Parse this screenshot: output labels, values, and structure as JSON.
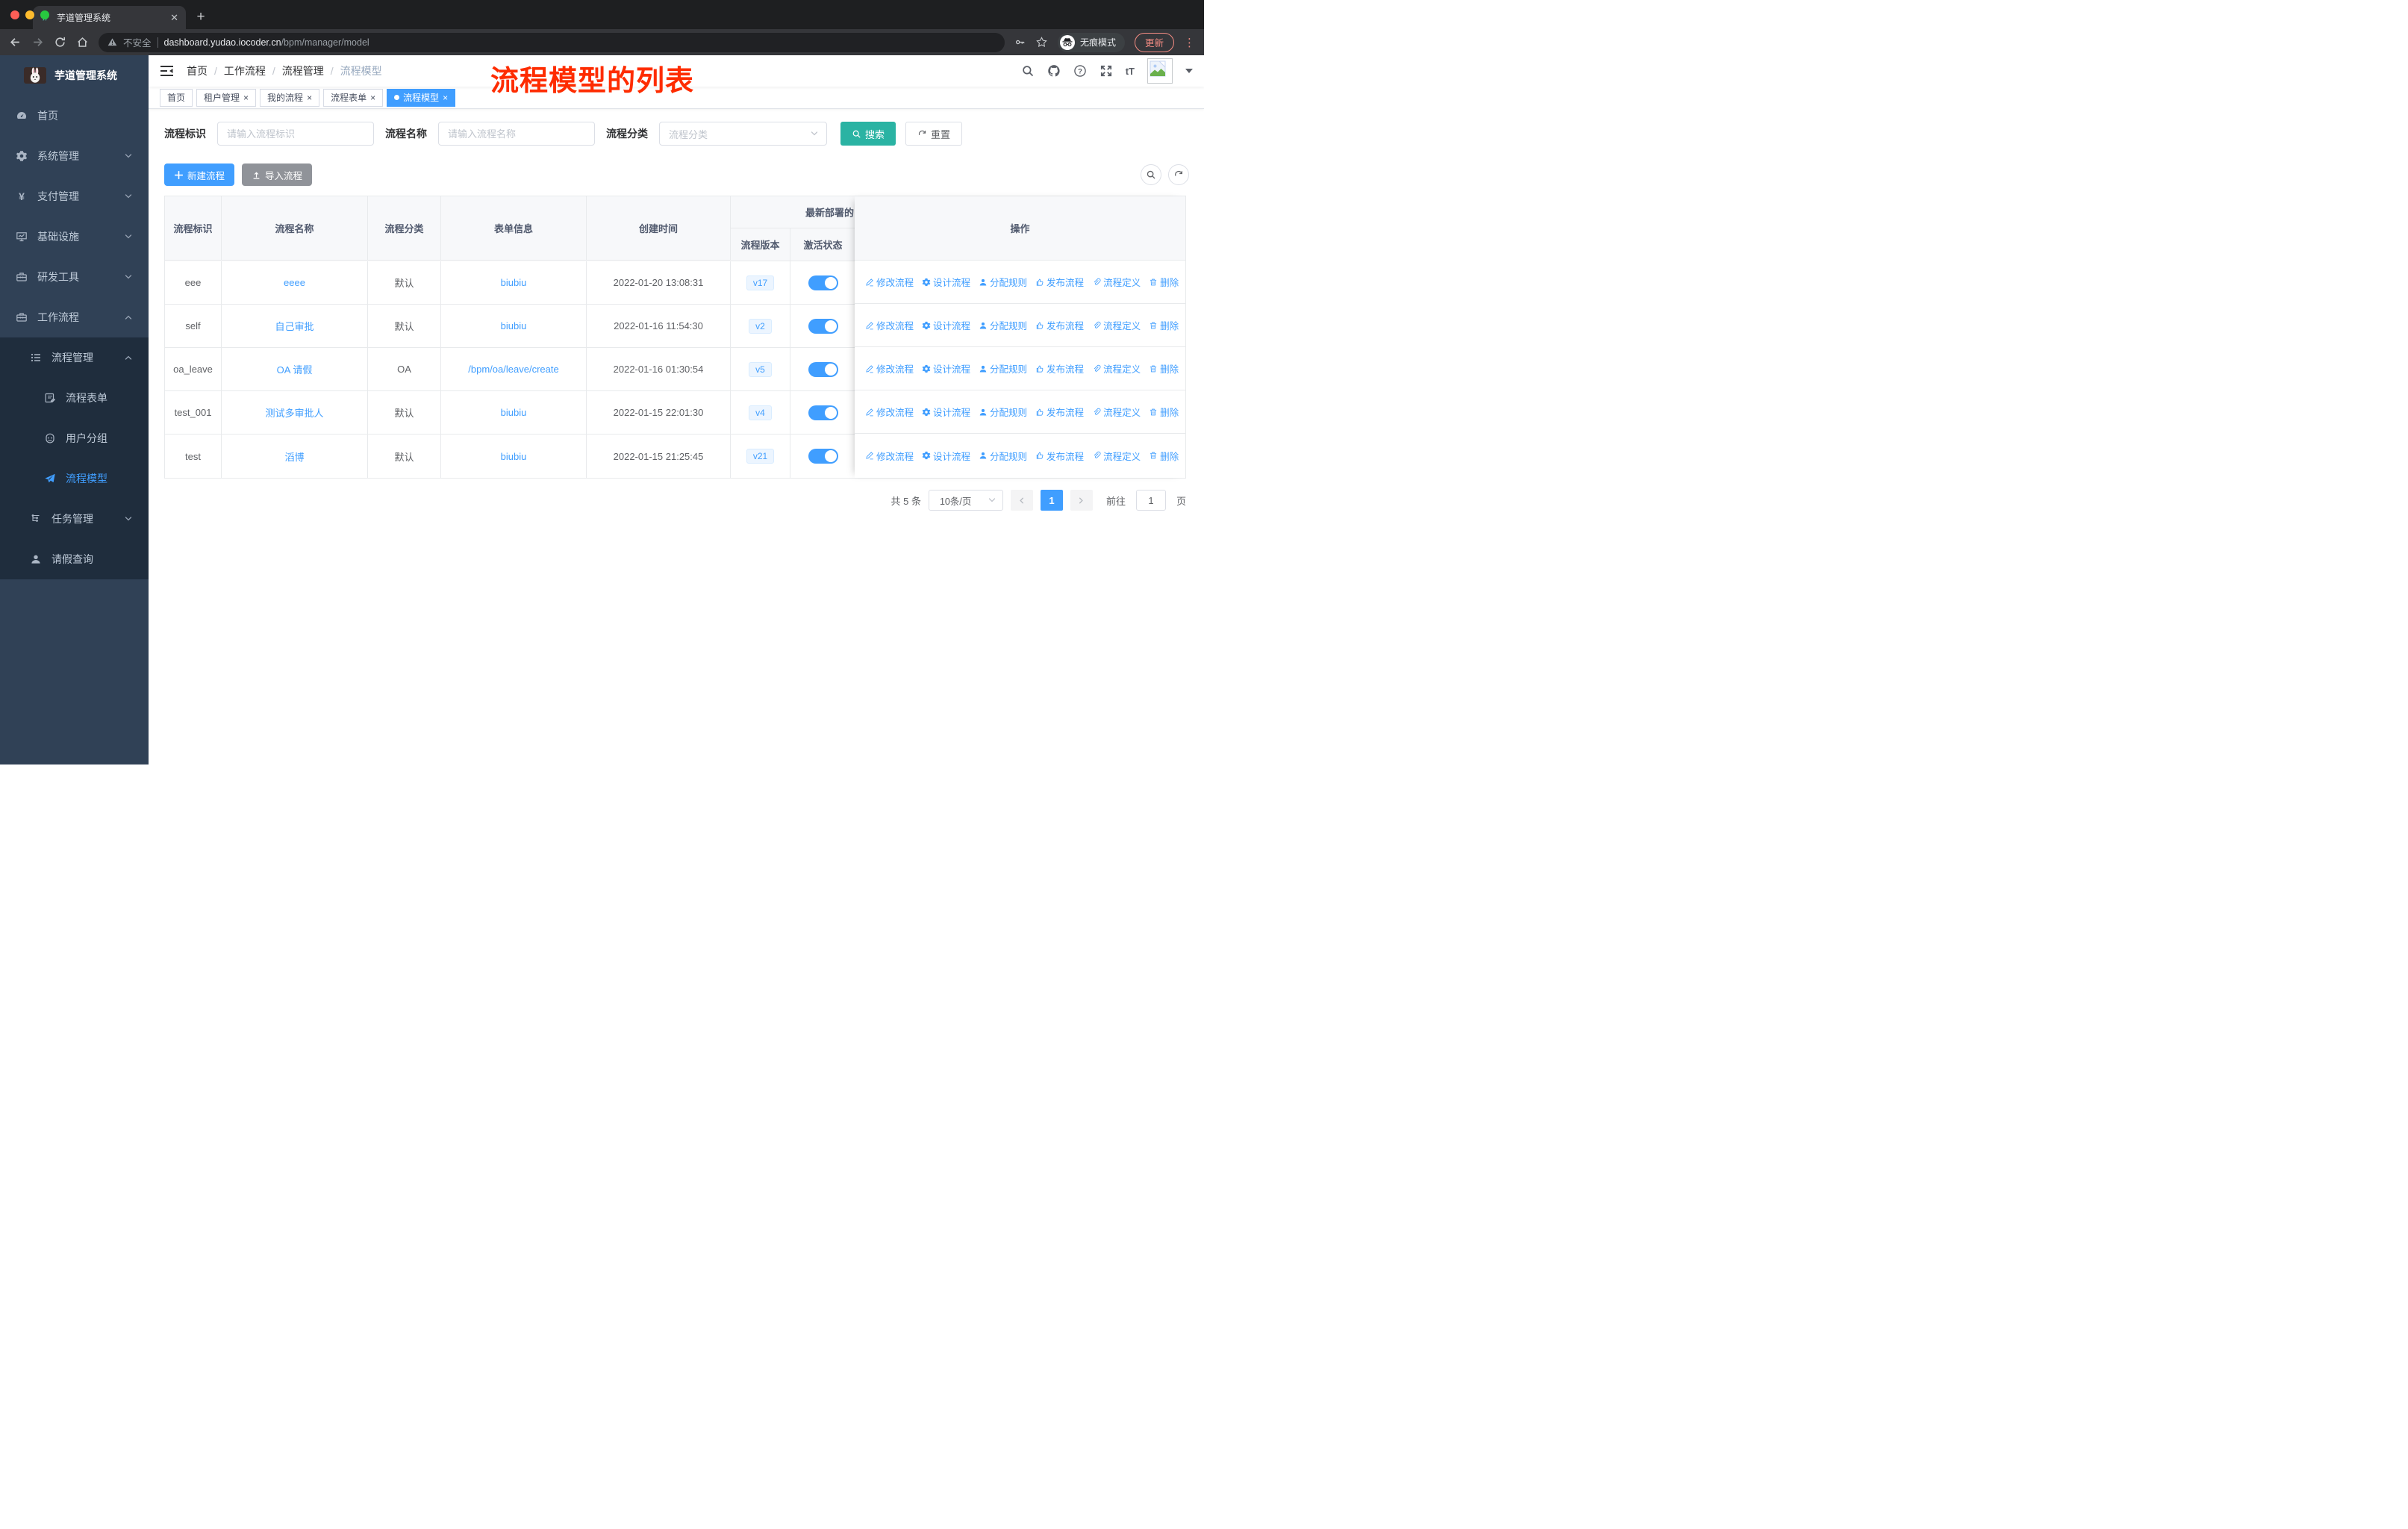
{
  "browser": {
    "tab_title": "芋道管理系统",
    "security_label": "不安全",
    "url_host": "dashboard.yudao.iocoder.cn",
    "url_path": "/bpm/manager/model",
    "incognito_label": "无痕模式",
    "update_label": "更新"
  },
  "sidebar": {
    "title": "芋道管理系统",
    "items": [
      {
        "label": "首页",
        "icon": "dashboard-icon",
        "level": 1
      },
      {
        "label": "系统管理",
        "icon": "gear-icon",
        "level": 1,
        "arrow": "down"
      },
      {
        "label": "支付管理",
        "icon": "yen-icon",
        "level": 1,
        "arrow": "down"
      },
      {
        "label": "基础设施",
        "icon": "monitor-icon",
        "level": 1,
        "arrow": "down"
      },
      {
        "label": "研发工具",
        "icon": "toolbox-icon",
        "level": 1,
        "arrow": "down"
      },
      {
        "label": "工作流程",
        "icon": "briefcase-icon",
        "level": 1,
        "arrow": "up"
      },
      {
        "label": "流程管理",
        "icon": "tree-list-icon",
        "level": 2,
        "arrow": "up",
        "sub": true
      },
      {
        "label": "流程表单",
        "icon": "form-icon",
        "level": 3,
        "sub": true
      },
      {
        "label": "用户分组",
        "icon": "user-group-icon",
        "level": 3,
        "sub": true
      },
      {
        "label": "流程模型",
        "icon": "paper-plane-icon",
        "level": 3,
        "sub": true,
        "active": true
      },
      {
        "label": "任务管理",
        "icon": "flow-tasks-icon",
        "level": 2,
        "arrow": "down",
        "sub": true
      },
      {
        "label": "请假查询",
        "icon": "person-icon",
        "level": 2,
        "sub": true
      }
    ]
  },
  "navbar": {
    "breadcrumb": [
      "首页",
      "工作流程",
      "流程管理",
      "流程模型"
    ],
    "annotation": "流程模型的列表"
  },
  "tags": [
    {
      "label": "首页",
      "closable": false,
      "active": false
    },
    {
      "label": "租户管理",
      "closable": true,
      "active": false
    },
    {
      "label": "我的流程",
      "closable": true,
      "active": false
    },
    {
      "label": "流程表单",
      "closable": true,
      "active": false
    },
    {
      "label": "流程模型",
      "closable": true,
      "active": true
    }
  ],
  "filters": {
    "key_label": "流程标识",
    "key_placeholder": "请输入流程标识",
    "name_label": "流程名称",
    "name_placeholder": "请输入流程名称",
    "category_label": "流程分类",
    "category_placeholder": "流程分类",
    "search_label": "搜索",
    "reset_label": "重置"
  },
  "toolbar": {
    "create_label": "新建流程",
    "import_label": "导入流程"
  },
  "table": {
    "headers": {
      "key": "流程标识",
      "name": "流程名称",
      "category": "流程分类",
      "form": "表单信息",
      "created": "创建时间",
      "deploy_group": "最新部署的",
      "version": "流程版本",
      "active": "激活状态",
      "actions": "操作"
    },
    "rows": [
      {
        "key": "eee",
        "name": "eeee",
        "category": "默认",
        "form": "biubiu",
        "created": "2022-01-20 13:08:31",
        "version": "v17",
        "active": true
      },
      {
        "key": "self",
        "name": "自己审批",
        "category": "默认",
        "form": "biubiu",
        "created": "2022-01-16 11:54:30",
        "version": "v2",
        "active": true
      },
      {
        "key": "oa_leave",
        "name": "OA 请假",
        "category": "OA",
        "form": "/bpm/oa/leave/create",
        "created": "2022-01-16 01:30:54",
        "version": "v5",
        "active": true
      },
      {
        "key": "test_001",
        "name": "测试多审批人",
        "category": "默认",
        "form": "biubiu",
        "created": "2022-01-15 22:01:30",
        "version": "v4",
        "active": true
      },
      {
        "key": "test",
        "name": "滔博",
        "category": "默认",
        "form": "biubiu",
        "created": "2022-01-15 21:25:45",
        "version": "v21",
        "active": true
      }
    ],
    "row_actions": [
      {
        "label": "修改流程",
        "icon": "edit-icon",
        "name": "modify-process-link"
      },
      {
        "label": "设计流程",
        "icon": "design-gear-icon",
        "name": "design-process-link"
      },
      {
        "label": "分配规则",
        "icon": "assign-user-icon",
        "name": "assign-rule-link"
      },
      {
        "label": "发布流程",
        "icon": "publish-icon",
        "name": "publish-process-link"
      },
      {
        "label": "流程定义",
        "icon": "paperclip-icon",
        "name": "process-definition-link"
      },
      {
        "label": "删除",
        "icon": "trash-icon",
        "name": "delete-link"
      }
    ]
  },
  "pagination": {
    "total_label": "共 5 条",
    "page_size": "10条/页",
    "current_page": "1",
    "goto_label": "前往",
    "goto_value": "1",
    "page_unit": "页"
  },
  "colors": {
    "primary": "#409eff",
    "search_button": "#2ab3a3",
    "import_button": "#909399",
    "sidebar_bg": "#304156",
    "sidebar_sub_bg": "#1f2d3d",
    "annotation_red": "#fe2c00",
    "tag_active": "#409eff"
  }
}
